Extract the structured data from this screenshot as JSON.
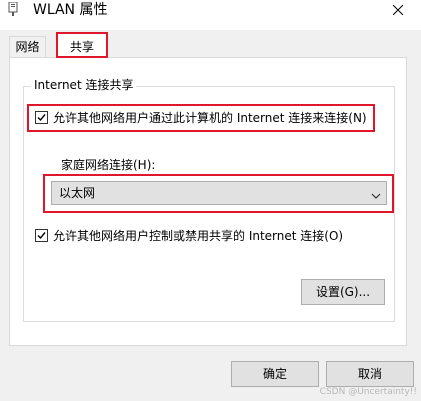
{
  "window": {
    "title": "WLAN  属性",
    "close_icon": "close-icon"
  },
  "tabs": [
    {
      "label": "网络",
      "selected": false
    },
    {
      "label": "共享",
      "selected": true
    }
  ],
  "sharing": {
    "group_title": "Internet 连接共享",
    "allow_share_label": "允许其他网络用户通过此计算机的 Internet 连接来连接(N)",
    "allow_share_checked": true,
    "home_network_label": "家庭网络连接(H):",
    "home_network_value": "以太网",
    "allow_control_label": "允许其他网络用户控制或禁用共享的 Internet 连接(O)",
    "allow_control_checked": true,
    "settings_button": "设置(G)..."
  },
  "footer": {
    "ok_button": "确定",
    "cancel_button": "取消"
  },
  "watermark": "CSDN @Uncertainty!!",
  "colors": {
    "highlight": "#e0162b",
    "dialog_bg": "#f0f0f0",
    "panel_bg": "#ffffff"
  }
}
